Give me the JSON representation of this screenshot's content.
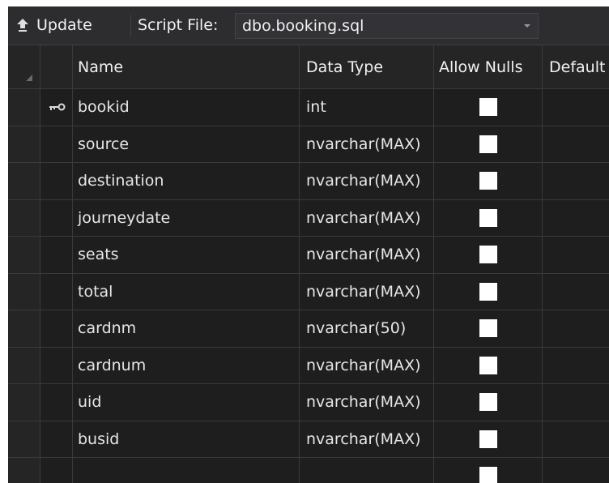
{
  "toolbar": {
    "update_label": "Update",
    "script_file_label": "Script File:",
    "script_file_value": "dbo.booking.sql"
  },
  "grid": {
    "columns": {
      "name": "Name",
      "data_type": "Data Type",
      "allow_nulls": "Allow Nulls",
      "default": "Default"
    },
    "rows": [
      {
        "name": "bookid",
        "type": "int",
        "key": true
      },
      {
        "name": "source",
        "type": "nvarchar(MAX)"
      },
      {
        "name": "destination",
        "type": "nvarchar(MAX)"
      },
      {
        "name": "journeydate",
        "type": "nvarchar(MAX)"
      },
      {
        "name": "seats",
        "type": "nvarchar(MAX)"
      },
      {
        "name": "total",
        "type": "nvarchar(MAX)"
      },
      {
        "name": "cardnm",
        "type": "nvarchar(50)"
      },
      {
        "name": "cardnum",
        "type": "nvarchar(MAX)"
      },
      {
        "name": "uid",
        "type": "nvarchar(MAX)"
      },
      {
        "name": "busid",
        "type": "nvarchar(MAX)"
      },
      {
        "name": "",
        "type": ""
      }
    ]
  },
  "colors": {
    "background": "#1e1e1e",
    "toolbar": "#2d2d30",
    "text": "#e6e6e6",
    "checkbox": "#ffffff"
  },
  "icons": {
    "update": "upload-arrow-icon",
    "primary_key": "key-icon",
    "dropdown": "chevron-down-icon"
  }
}
